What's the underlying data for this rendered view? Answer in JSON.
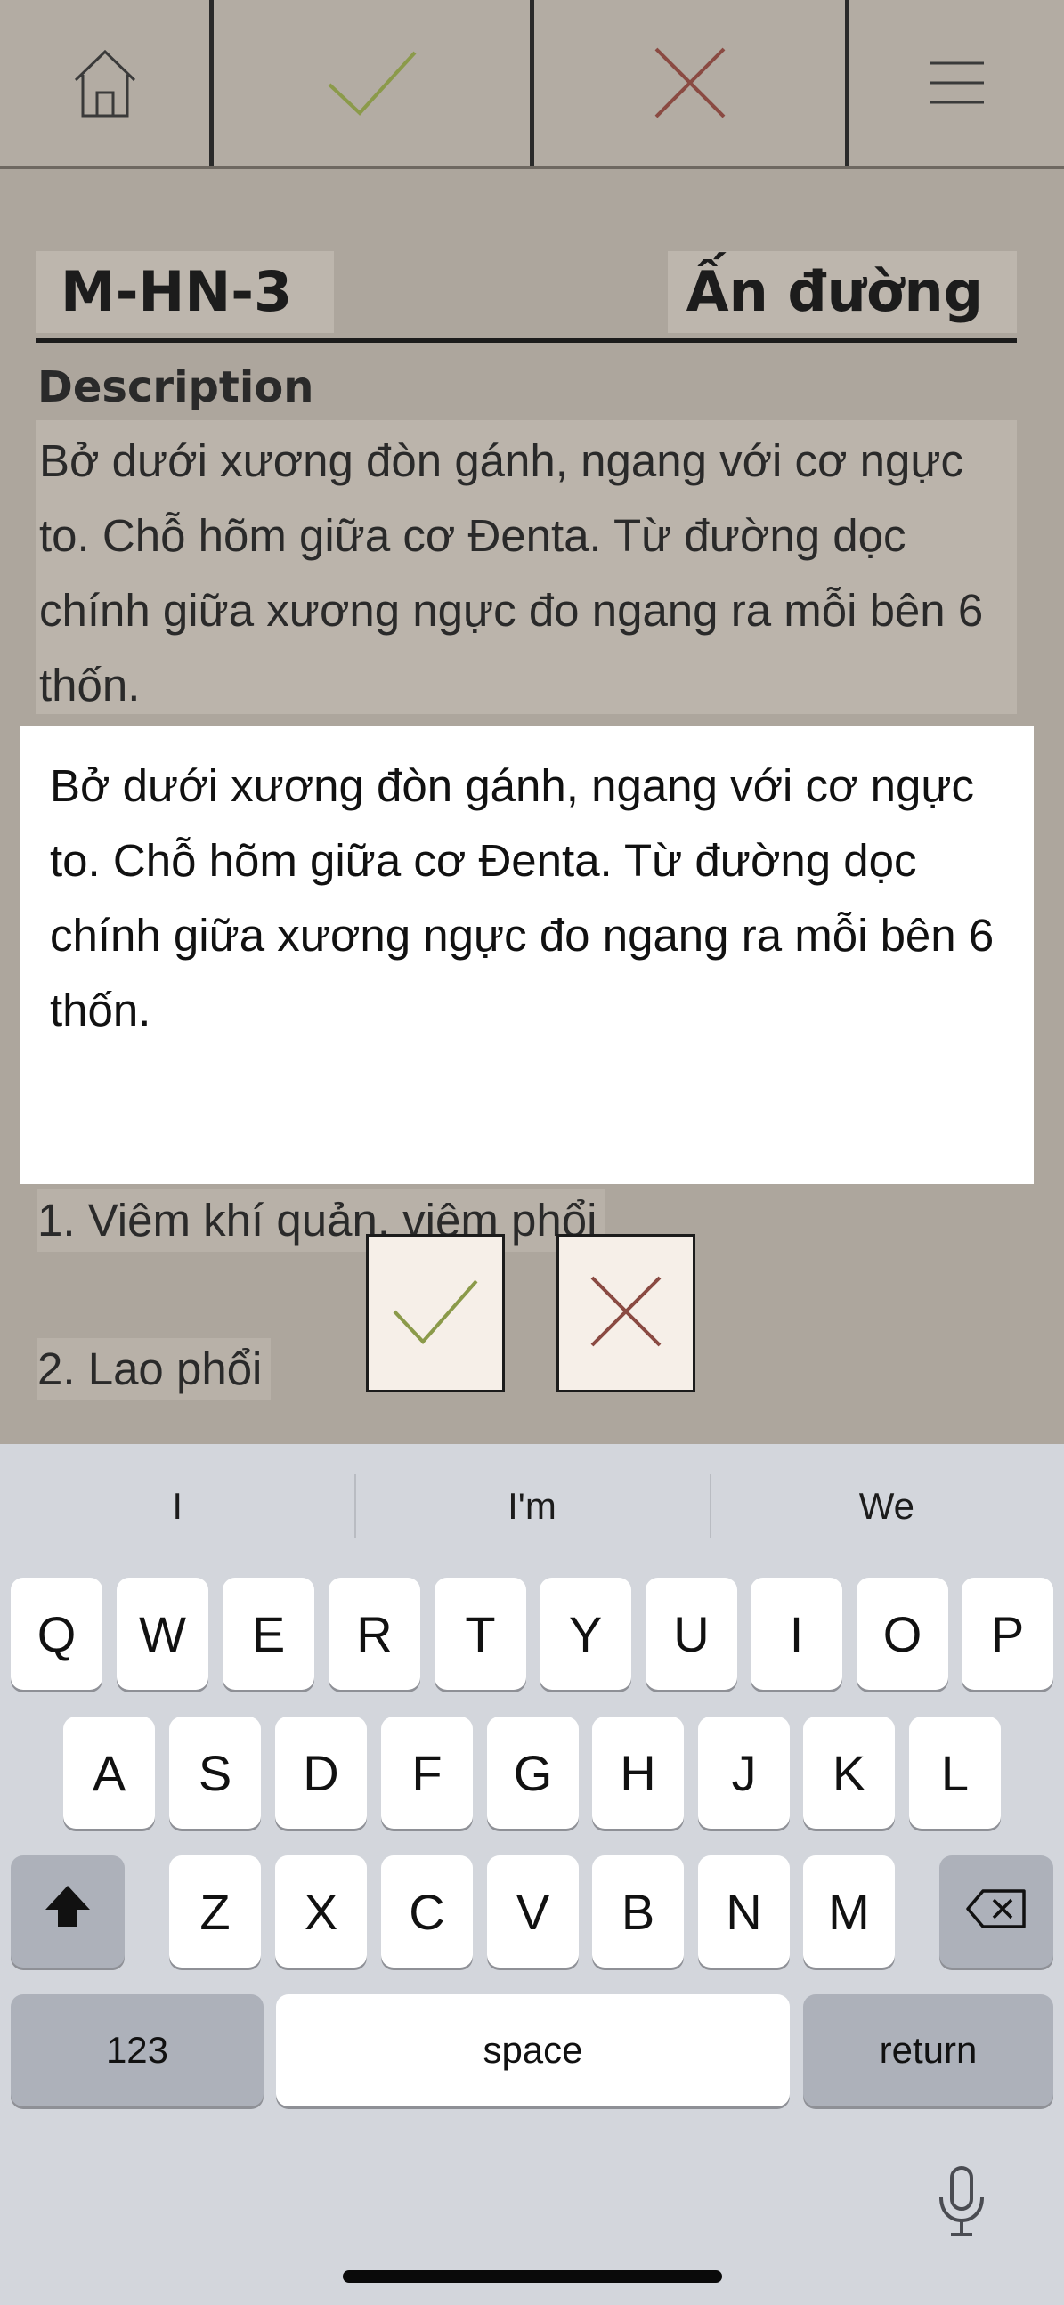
{
  "toolbar": {
    "buttons": [
      {
        "icon": "home-icon"
      },
      {
        "icon": "checkmark-icon",
        "color": "#8b9a4a"
      },
      {
        "icon": "close-icon",
        "color": "#8a4a42"
      },
      {
        "icon": "menu-icon"
      }
    ]
  },
  "point": {
    "code": "M-HN-3",
    "name": "Ấn đường"
  },
  "description": {
    "heading": "Description",
    "text": "Bở dưới xương đòn gánh, ngang với cơ ngực to. Chỗ hõm giữa cơ Đenta. Từ đường dọc chính giữa xương ngực đo ngang ra mỗi bên 6 thốn."
  },
  "editor": {
    "value": "Bở dưới xương đòn gánh, ngang với cơ ngực to. Chỗ hõm giữa cơ Đenta. Từ đường dọc chính giữa xương ngực đo ngang ra mỗi bên 6 thốn."
  },
  "indications": [
    "1. Viêm khí quản, viêm phổi",
    "2. Lao phổi"
  ],
  "keyboard": {
    "suggestions": [
      "I",
      "I'm",
      "We"
    ],
    "row1": [
      "Q",
      "W",
      "E",
      "R",
      "T",
      "Y",
      "U",
      "I",
      "O",
      "P"
    ],
    "row2": [
      "A",
      "S",
      "D",
      "F",
      "G",
      "H",
      "J",
      "K",
      "L"
    ],
    "row3": [
      "Z",
      "X",
      "C",
      "V",
      "B",
      "N",
      "M"
    ],
    "numbers_label": "123",
    "space_label": "space",
    "return_label": "return"
  }
}
